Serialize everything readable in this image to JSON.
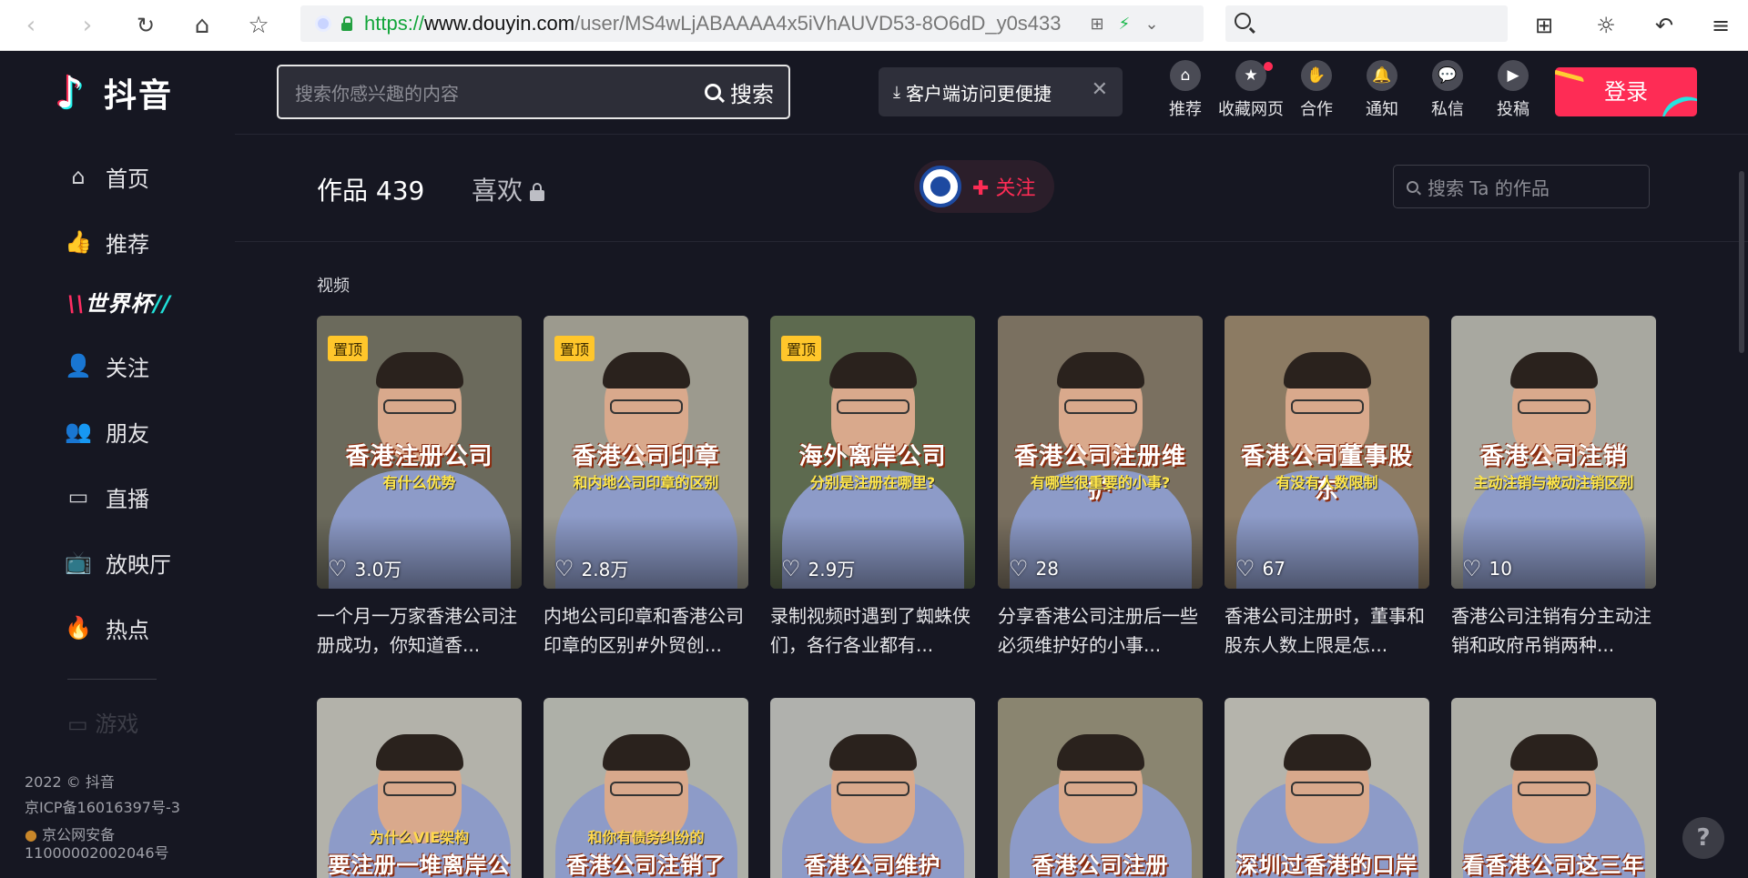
{
  "browser": {
    "url_scheme": "https://",
    "url_host": "www.douyin.com",
    "url_path": "/user/MS4wLjABAAAA4x5iVhAUVD53-8O6dD_y0s433",
    "back_icon": "back-arrow-icon",
    "forward_icon": "forward-arrow-icon"
  },
  "app": {
    "name": "抖音",
    "search_placeholder": "搜索你感兴趣的内容",
    "search_button": "搜索",
    "client_tip": "客户端访问更便捷",
    "login": "登录"
  },
  "topbar": [
    {
      "label": "推荐",
      "icon": "home-icon",
      "glyph": "⌂",
      "dot": false
    },
    {
      "label": "收藏网页",
      "icon": "star-icon",
      "glyph": "★",
      "dot": true
    },
    {
      "label": "合作",
      "icon": "handshake-icon",
      "glyph": "✋",
      "dot": false
    },
    {
      "label": "通知",
      "icon": "bell-icon",
      "glyph": "🔔",
      "dot": false
    },
    {
      "label": "私信",
      "icon": "message-icon",
      "glyph": "💬",
      "dot": false
    },
    {
      "label": "投稿",
      "icon": "camera-icon",
      "glyph": "▶",
      "dot": false
    }
  ],
  "sidebar": {
    "items": [
      {
        "label": "首页",
        "icon": "home-icon",
        "glyph": "⌂"
      },
      {
        "label": "推荐",
        "icon": "thumbs-up-icon",
        "glyph": "👍"
      },
      {
        "label": "关注",
        "icon": "add-user-icon",
        "glyph": "👤"
      },
      {
        "label": "朋友",
        "icon": "friends-icon",
        "glyph": "👥"
      },
      {
        "label": "直播",
        "icon": "live-icon",
        "glyph": "▭"
      },
      {
        "label": "放映厅",
        "icon": "tv-icon",
        "glyph": "📺"
      },
      {
        "label": "热点",
        "icon": "flame-icon",
        "glyph": "🔥"
      }
    ],
    "worldcup": "世界杯",
    "faded_item": "游戏",
    "footer": [
      "2022 © 抖音",
      "京ICP备16016397号-3",
      "京公网安备",
      "11000002002046号"
    ]
  },
  "profile": {
    "works_tab": "作品 439",
    "likes_tab": "喜欢",
    "follow": "关注",
    "search_placeholder": "搜索 Ta 的作品",
    "section": "视频"
  },
  "videos_row1": [
    {
      "pinned": "置顶",
      "likes": "3.0万",
      "cap1": "香港注册公司",
      "cap2": "有什么优势",
      "bg": "#6b6a5c",
      "desc": "一个月一万家香港公司注册成功，你知道香..."
    },
    {
      "pinned": "置顶",
      "likes": "2.8万",
      "cap1": "香港公司印章",
      "cap2": "和内地公司印章的区别",
      "bg": "#9c9a8e",
      "desc": "内地公司印章和香港公司印章的区别#外贸创..."
    },
    {
      "pinned": "置顶",
      "likes": "2.9万",
      "cap1": "海外离岸公司",
      "cap2": "分别是注册在哪里?",
      "bg": "#5d6a4f",
      "desc": "录制视频时遇到了蜘蛛侠们，各行各业都有..."
    },
    {
      "pinned": "",
      "likes": "28",
      "cap1": "香港公司注册维护",
      "cap2": "有哪些很重要的小事?",
      "bg": "#7a7060",
      "desc": "分享香港公司注册后一些必须维护好的小事..."
    },
    {
      "pinned": "",
      "likes": "67",
      "cap1": "香港公司董事股东",
      "cap2": "有没有人数限制",
      "bg": "#8c7b63",
      "desc": "香港公司注册时，董事和股东人数上限是怎..."
    },
    {
      "pinned": "",
      "likes": "10",
      "cap1": "香港公司注销",
      "cap2": "主动注销与被动注销区别",
      "bg": "#a8a8a0",
      "desc": "香港公司注销有分主动注销和政府吊销两种..."
    }
  ],
  "videos_row2": [
    {
      "cap1": "要注册一堆离岸公司",
      "cap2": "为什么VIE架构",
      "bg": "#b3b2aa"
    },
    {
      "cap1": "香港公司注销了",
      "cap2": "和你有债务纠纷的",
      "bg": "#aeb0a8"
    },
    {
      "cap1": "香港公司维护",
      "cap2": "",
      "bg": "#b0b1ad"
    },
    {
      "cap1": "香港公司注册",
      "cap2": "",
      "bg": "#8a8570"
    },
    {
      "cap1": "深圳过香港的口岸",
      "cap2": "",
      "bg": "#b5b4ac"
    },
    {
      "cap1": "看香港公司这三年",
      "cap2": "",
      "bg": "#aeaea6"
    }
  ]
}
